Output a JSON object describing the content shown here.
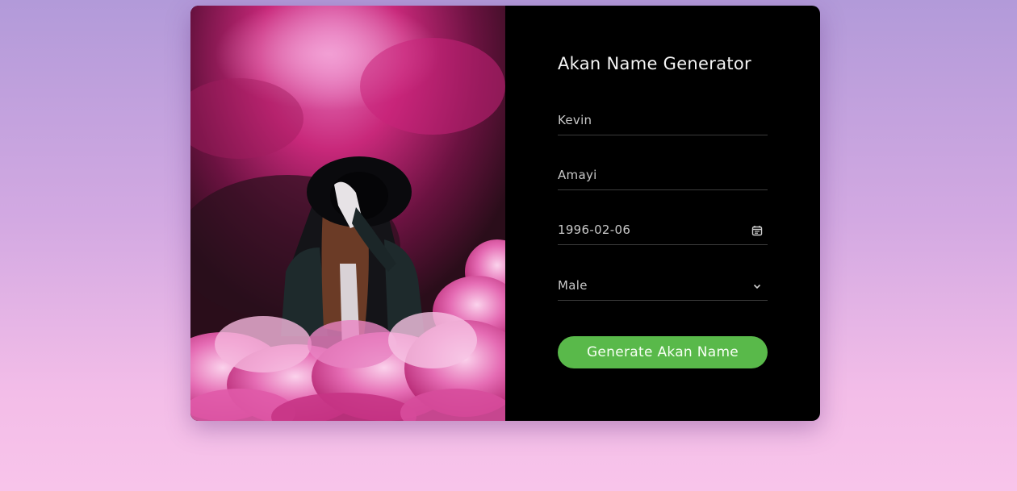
{
  "card": {
    "title": "Akan Name Generator",
    "first_name": {
      "value": "Kevin"
    },
    "last_name": {
      "value": "Amayi"
    },
    "birth_date": {
      "value": "1996-02-06",
      "icon": "calendar-icon"
    },
    "gender": {
      "selected": "Male",
      "icon": "chevron-down-icon"
    },
    "submit_label": "Generate Akan Name"
  },
  "colors": {
    "panel_bg": "#000000",
    "button_bg": "#59b94a",
    "smoke_pink": "#d3347f"
  }
}
